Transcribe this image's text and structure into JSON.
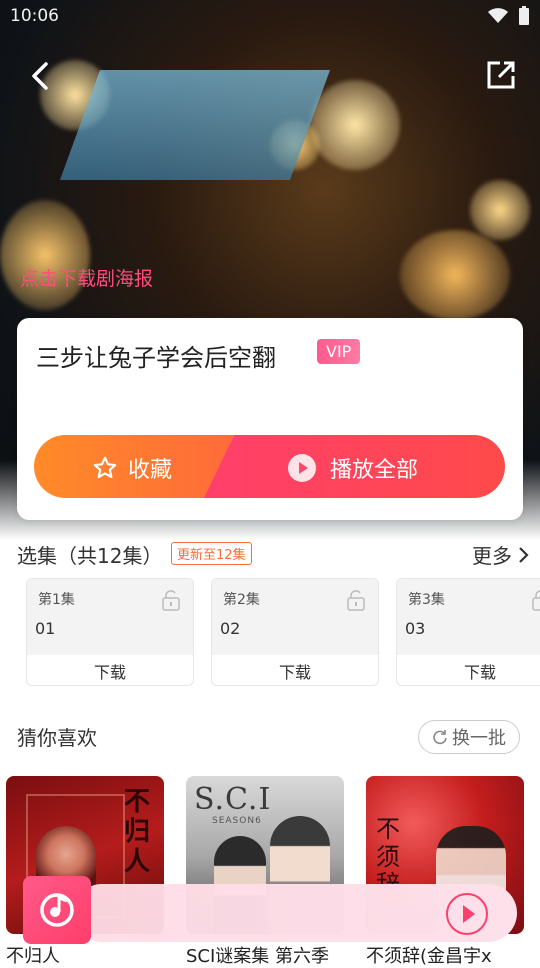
{
  "status_bar": {
    "time": "10:06"
  },
  "hero": {
    "download_poster": "点击下载剧海报"
  },
  "album": {
    "title": "三步让兔子学会后空翻",
    "badge": "VIP",
    "favorite_label": "收藏",
    "play_all_label": "播放全部"
  },
  "episodes": {
    "header": "选集（共12集）",
    "update_badge": "更新至12集",
    "more_label": "更多",
    "items": [
      {
        "name": "第1集",
        "number": "01",
        "action": "下载"
      },
      {
        "name": "第2集",
        "number": "02",
        "action": "下载"
      },
      {
        "name": "第3集",
        "number": "03",
        "action": "下载"
      }
    ]
  },
  "recommend": {
    "header": "猜你喜欢",
    "refresh_label": "换一批",
    "items": [
      {
        "caption": "不归人",
        "cover_text": "不归人"
      },
      {
        "caption": "SCI谜案集 第六季",
        "cover_text": "S.C.I",
        "cover_sub": "SEASON6"
      },
      {
        "caption": "不须辞(金昌宇x",
        "cover_text": "不须辞"
      }
    ]
  },
  "colors": {
    "accent_pink": "#ff3f6b",
    "accent_orange": "#ff7a30",
    "vip_badge": "#ff6b96"
  }
}
